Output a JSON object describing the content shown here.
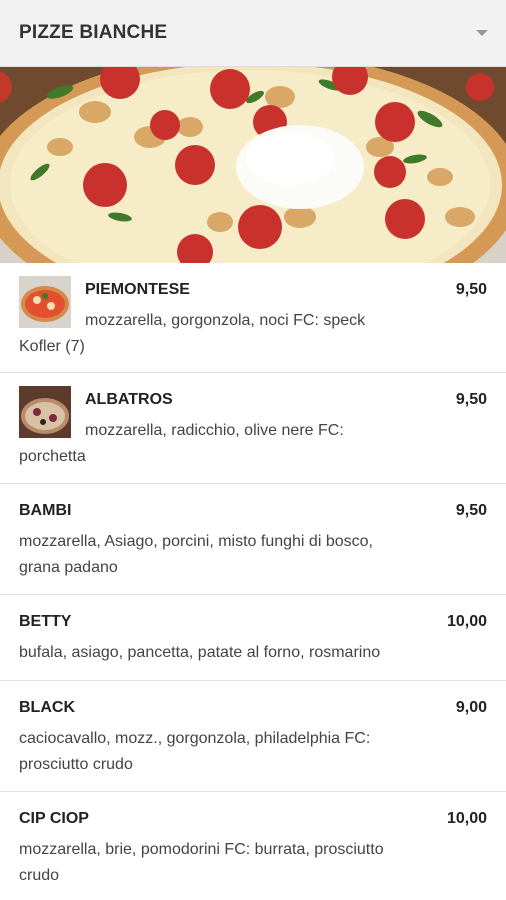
{
  "header": {
    "title": "PIZZE BIANCHE",
    "toggle_icon": "caret-down-icon"
  },
  "hero": {
    "image": "pizza-hero-image"
  },
  "items": [
    {
      "name": "PIEMONTESE",
      "price": "9,50",
      "desc_line1": "mozzarella, gorgonzola, noci FC: speck",
      "desc_line2": "Kofler (7)",
      "thumbnail": "pizza-thumbnail-image"
    },
    {
      "name": "ALBATROS",
      "price": "9,50",
      "desc_line1": "mozzarella, radicchio, olive nere FC:",
      "desc_line2": "porchetta",
      "thumbnail": "pizza-thumbnail-image"
    },
    {
      "name": "BAMBI",
      "price": "9,50",
      "desc_line1": "mozzarella, Asiago, porcini, misto funghi di bosco,",
      "desc_line2": "grana padano"
    },
    {
      "name": "BETTY",
      "price": "10,00",
      "desc_line1": "bufala, asiago, pancetta, patate al forno, rosmarino"
    },
    {
      "name": "BLACK",
      "price": "9,00",
      "desc_line1": "caciocavallo, mozz., gorgonzola, philadelphia FC:",
      "desc_line2": "prosciutto crudo"
    },
    {
      "name": "CIP CIOP",
      "price": "10,00",
      "desc_line1": "mozzarella, brie, pomodorini FC: burrata, prosciutto",
      "desc_line2": "crudo"
    }
  ],
  "colors": {
    "header_bg": "#f2f2f2",
    "pepperoni": "#c9322c",
    "cheese": "#f4e6c0"
  }
}
